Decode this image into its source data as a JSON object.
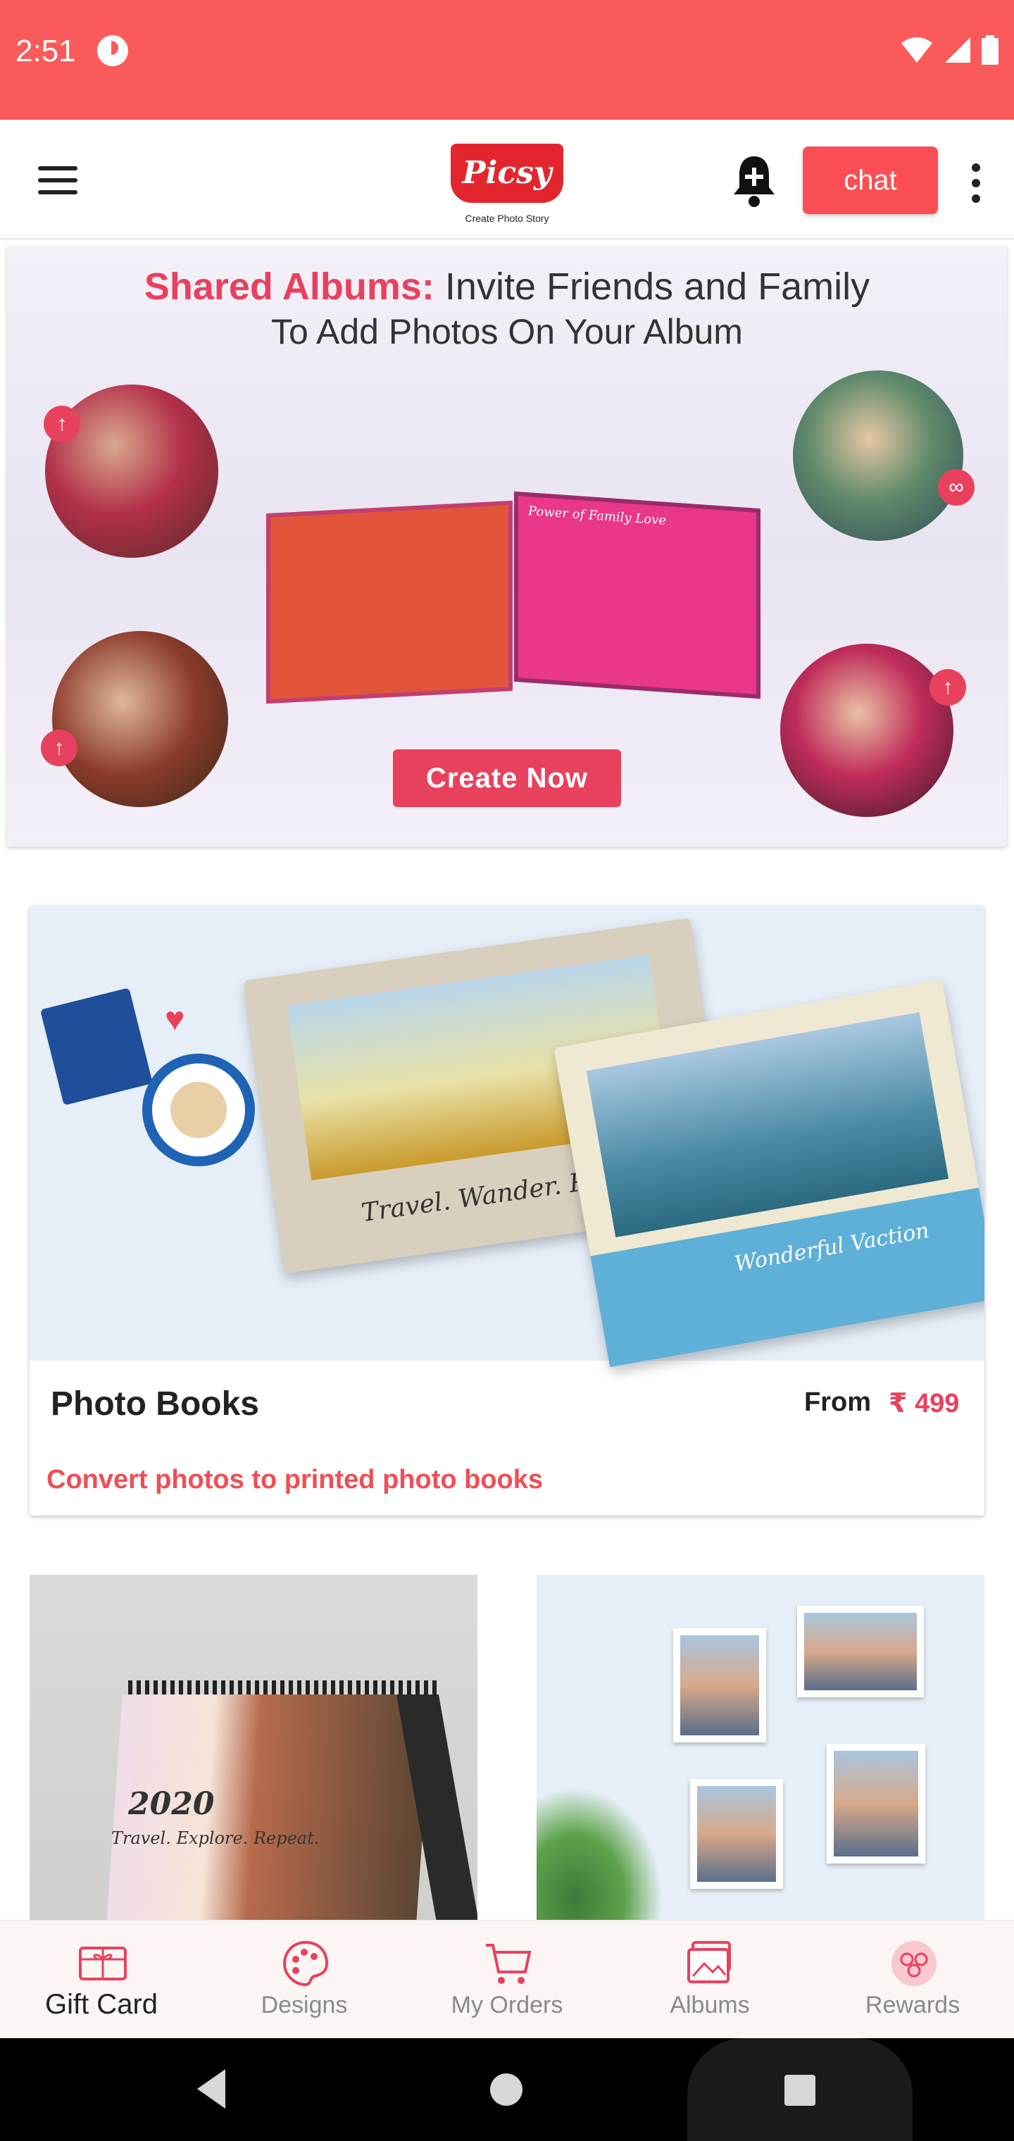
{
  "status_bar": {
    "time": "2:51",
    "icons": [
      "data-saver-icon",
      "wifi-icon",
      "signal-icon",
      "battery-icon"
    ],
    "bg_color": "#fb5a5b"
  },
  "app_bar": {
    "logo_text": "Picsy",
    "logo_tagline": "Create Photo Story",
    "chat_label": "chat",
    "icons": [
      "hamburger-menu-icon",
      "notification-bell-icon",
      "overflow-menu-icon"
    ]
  },
  "banner": {
    "title_highlight": "Shared Albums:",
    "title_rest": " Invite Friends and Family",
    "subtitle": "To Add Photos On Your Album",
    "album_caption": "Power of Family Love",
    "cta_label": "Create Now"
  },
  "product_card": {
    "title": "Photo Books",
    "from_label": "From",
    "price": "₹ 499",
    "subtitle": "Convert photos to printed photo books",
    "image_caption_1": "Travel. Wander. Repeat.",
    "image_caption_2": "Wonderful Vaction"
  },
  "tiles": {
    "calendar_year": "2020",
    "calendar_caption": "Travel. Explore. Repeat."
  },
  "bottom_nav": {
    "items": [
      {
        "label": "Gift Card",
        "icon": "gift-card-icon",
        "active": true
      },
      {
        "label": "Designs",
        "icon": "palette-icon",
        "active": false
      },
      {
        "label": "My Orders",
        "icon": "cart-icon",
        "active": false
      },
      {
        "label": "Albums",
        "icon": "albums-icon",
        "active": false
      },
      {
        "label": "Rewards",
        "icon": "rewards-icon",
        "active": false
      }
    ],
    "accent_color": "#e8415e"
  }
}
